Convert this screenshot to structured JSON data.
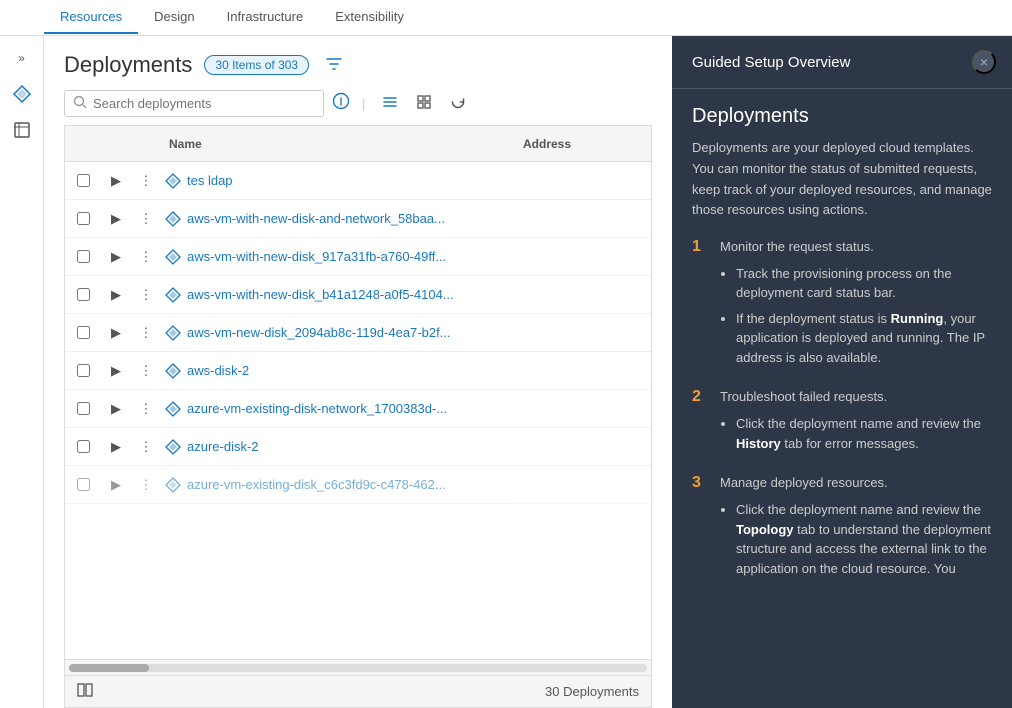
{
  "nav": {
    "tabs": [
      {
        "label": "Resources",
        "active": true
      },
      {
        "label": "Design",
        "active": false
      },
      {
        "label": "Infrastructure",
        "active": false
      },
      {
        "label": "Extensibility",
        "active": false
      }
    ]
  },
  "sidebar": {
    "collapse_label": "«",
    "icons": [
      "diamond-icon",
      "cube-icon"
    ]
  },
  "page": {
    "title": "Deployments",
    "items_badge": "30 Items of 303",
    "search_placeholder": "Search deployments",
    "info_tooltip": "Info",
    "view_list": "List view",
    "view_grid": "Grid view",
    "refresh": "Refresh"
  },
  "table": {
    "columns": [
      "Name",
      "Address"
    ],
    "rows": [
      {
        "name": "tes ldap",
        "address": ""
      },
      {
        "name": "aws-vm-with-new-disk-and-network_58baa...",
        "address": ""
      },
      {
        "name": "aws-vm-with-new-disk_917a31fb-a760-49ff...",
        "address": ""
      },
      {
        "name": "aws-vm-with-new-disk_b41a1248-a0f5-4104...",
        "address": ""
      },
      {
        "name": "aws-vm-new-disk_2094ab8c-119d-4ea7-b2f...",
        "address": ""
      },
      {
        "name": "aws-disk-2",
        "address": ""
      },
      {
        "name": "azure-vm-existing-disk-network_1700383d-...",
        "address": ""
      },
      {
        "name": "azure-disk-2",
        "address": ""
      },
      {
        "name": "azure-vm-existing-disk_c6c3fd9c-c478-462...",
        "address": ""
      }
    ],
    "footer_count": "30 Deployments"
  },
  "guided_panel": {
    "title": "Guided Setup Overview",
    "section_title": "Deployments",
    "description": "Deployments are your deployed cloud templates. You can monitor the status of submitted requests, keep track of your deployed resources, and manage those resources using actions.",
    "steps": [
      {
        "number": "1",
        "header": "Monitor the request status.",
        "bullets": [
          "Track the provisioning process on the deployment card status bar.",
          "If the deployment status is Running, your application is deployed and running. The IP address is also available."
        ]
      },
      {
        "number": "2",
        "header": "Troubleshoot failed requests.",
        "bullets": [
          "Click the deployment name and review the **History** tab for error messages."
        ]
      },
      {
        "number": "3",
        "header": "Manage deployed resources.",
        "bullets": [
          "Click the deployment name and review the **Topology** tab to understand the deployment structure and access the external link to the application on the cloud resource. You"
        ]
      }
    ],
    "close_label": "×"
  }
}
